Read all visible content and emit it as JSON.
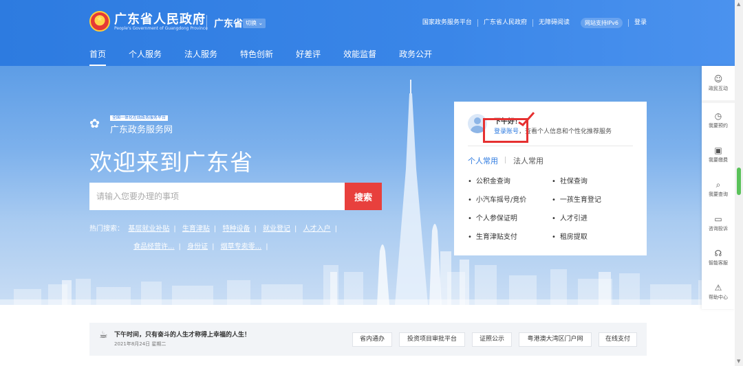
{
  "header": {
    "site_title": "广东省人民政府",
    "site_subtitle": "People's Government of Guangdong Province",
    "region": "广东省",
    "switch_label": "切换",
    "top_links": [
      "国家政务服务平台",
      "广东省人民政府",
      "无障碍阅读"
    ],
    "ipv6_badge": "网站支持IPv6",
    "login": "登录",
    "nav": [
      "首页",
      "个人服务",
      "法人服务",
      "特色创新",
      "好差评",
      "效能监督",
      "政务公开"
    ]
  },
  "hero": {
    "brand_tag": "全国一体化在线政务服务平台",
    "brand_name": "广东政务服务网",
    "welcome": "欢迎来到广东省",
    "search_placeholder": "请输入您要办理的事项",
    "search_button": "搜索",
    "hot_label": "热门搜索：",
    "hot_items": [
      "基层就业补贴",
      "生育津贴",
      "特种设备",
      "就业登记",
      "人才入户",
      "食品经营许...",
      "身份证",
      "烟草专卖零..."
    ]
  },
  "card": {
    "greeting": "下午好！",
    "login_link": "登录账号",
    "login_desc": "，查看个人信息和个性化推荐服务",
    "tab_personal": "个人常用",
    "tab_legal": "法人常用",
    "services": [
      "公积金查询",
      "社保查询",
      "小汽车摇号/竞价",
      "一孩生育登记",
      "个人参保证明",
      "人才引进",
      "生育津贴支付",
      "租房提取"
    ]
  },
  "sidebar": [
    {
      "label": "政民互动",
      "icon": "chat-icon"
    },
    {
      "label": "我要预约",
      "icon": "clock-icon"
    },
    {
      "label": "我要缴费",
      "icon": "payment-icon"
    },
    {
      "label": "我要查询",
      "icon": "search-icon"
    },
    {
      "label": "咨询投诉",
      "icon": "message-icon"
    },
    {
      "label": "智能客服",
      "icon": "headset-icon"
    },
    {
      "label": "帮助中心",
      "icon": "help-icon"
    }
  ],
  "notice": {
    "text": "下午时间，只有奋斗的人生才称得上幸福的人生！",
    "date": "2021年8月24日 星期二",
    "buttons": [
      "省内通办",
      "投资项目审批平台",
      "证照公示",
      "粤港澳大湾区门户网",
      "在线支付"
    ]
  },
  "colors": {
    "primary": "#2f7be0",
    "search_button": "#e8403d",
    "highlight": "#e63030"
  }
}
